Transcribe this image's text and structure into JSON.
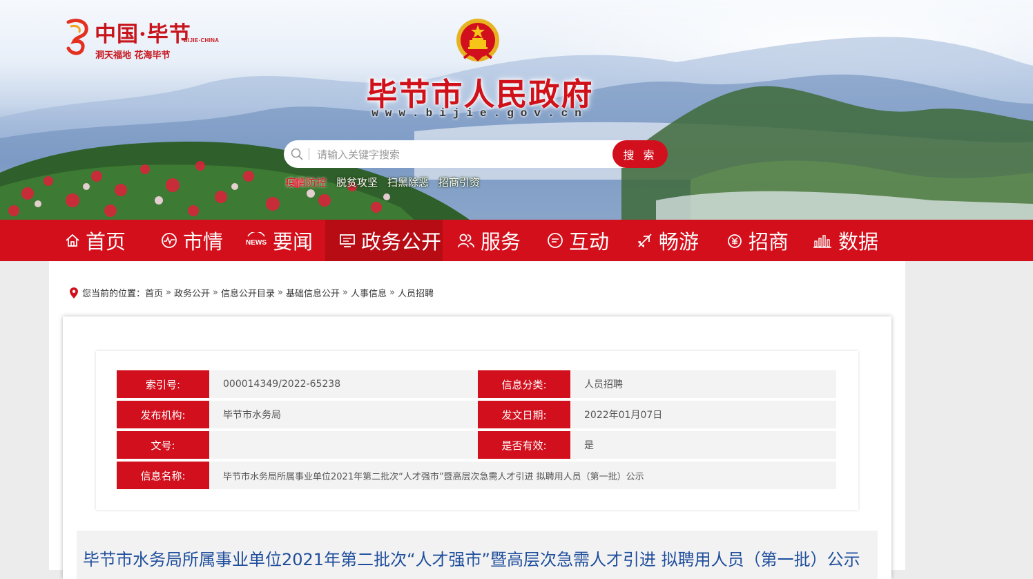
{
  "header": {
    "logo": {
      "title": "中国·毕节",
      "en": "BIJIE·CHINA",
      "slogan": "洞天福地  花海毕节"
    },
    "site_title": "毕节市人民政府",
    "site_url": "www.bijie.gov.cn",
    "search": {
      "placeholder": "请输入关键字搜索",
      "button": "搜 索"
    },
    "hot_links": [
      "疫情防控",
      "脱贫攻坚",
      "扫黑除恶",
      "招商引资"
    ]
  },
  "nav": {
    "items": [
      {
        "label": "首页",
        "icon": "home-icon"
      },
      {
        "label": "市情",
        "icon": "pulse-icon"
      },
      {
        "label": "要闻",
        "icon": "news-icon"
      },
      {
        "label": "政务公开",
        "icon": "monitor-icon",
        "active": true
      },
      {
        "label": "服务",
        "icon": "people-icon"
      },
      {
        "label": "互动",
        "icon": "chat-icon"
      },
      {
        "label": "畅游",
        "icon": "plane-icon"
      },
      {
        "label": "招商",
        "icon": "yuan-icon"
      },
      {
        "label": "数据",
        "icon": "bar-chart-icon"
      }
    ]
  },
  "breadcrumb": {
    "prefix": "您当前的位置：",
    "items": [
      "首页",
      "政务公开",
      "信息公开目录",
      "基础信息公开",
      "人事信息",
      "人员招聘"
    ]
  },
  "meta": {
    "index_label": "索引号:",
    "index_value": "000014349/2022-65238",
    "category_label": "信息分类:",
    "category_value": "人员招聘",
    "publisher_label": "发布机构:",
    "publisher_value": "毕节市水务局",
    "date_label": "发文日期:",
    "date_value": "2022年01月07日",
    "docno_label": "文号:",
    "docno_value": "",
    "valid_label": "是否有效:",
    "valid_value": "是",
    "name_label": "信息名称:",
    "name_value": "毕节市水务局所属事业单位2021年第二批次“人才强市”暨高层次急需人才引进 拟聘用人员（第一批）公示"
  },
  "article": {
    "title": "毕节市水务局所属事业单位2021年第二批次“人才强市”暨高层次急需人才引进 拟聘用人员（第一批）公示"
  },
  "colors": {
    "brand_red": "#d20f1c",
    "title_blue": "#1f4e9c"
  }
}
